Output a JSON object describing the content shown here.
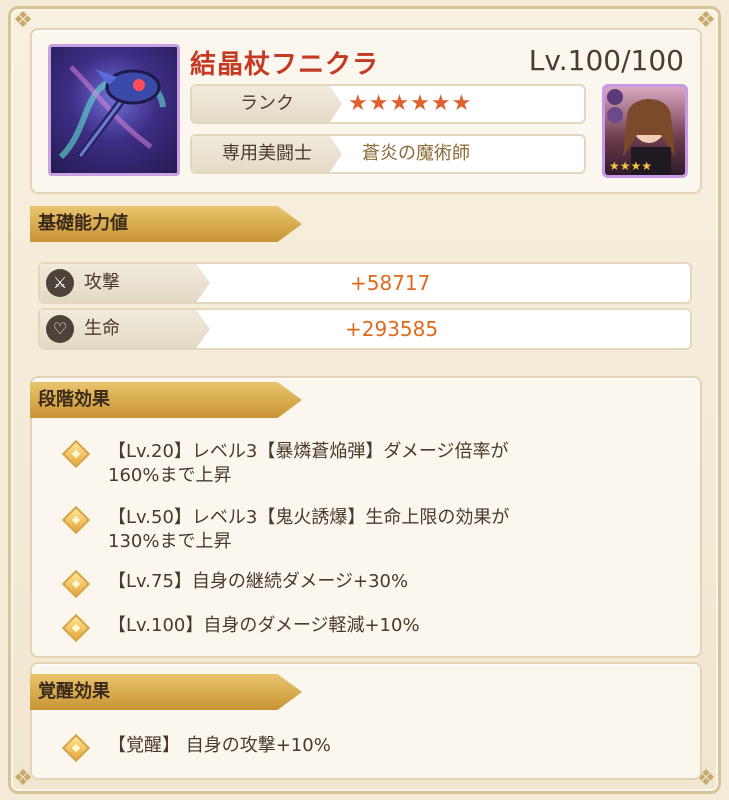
{
  "item": {
    "name": "結晶杖フニクラ",
    "level": "Lv.100/100",
    "rank_label": "ランク",
    "rank_stars": "★★★★★★",
    "rank_value": 6,
    "exclusive_label": "専用美闘士",
    "exclusive_value": "蒼炎の魔術師"
  },
  "sections": {
    "base_stats_title": "基礎能力値",
    "stage_effects_title": "段階効果",
    "awakening_title": "覚醒効果"
  },
  "stats": [
    {
      "label": "攻撃",
      "value": "+58717",
      "icon": "crossed-swords-icon"
    },
    {
      "label": "生命",
      "value": "+293585",
      "icon": "heart-icon"
    }
  ],
  "stage_effects": [
    {
      "line1": "【Lv.20】レベル3【暴燐蒼焔弾】ダメージ倍率が",
      "line2": "160%まで上昇"
    },
    {
      "line1": "【Lv.50】レベル3【鬼火誘爆】生命上限の効果が",
      "line2": "130%まで上昇"
    },
    {
      "line1": "【Lv.75】自身の継続ダメージ+30%",
      "line2": ""
    },
    {
      "line1": "【Lv.100】自身のダメージ軽減+10%",
      "line2": ""
    }
  ],
  "awakening_effects": [
    {
      "text": "【覚醒】 自身の攻撃+10%"
    }
  ],
  "portrait": {
    "stars": "★★★★"
  },
  "colors": {
    "title": "#c43a23",
    "value_orange": "#e06a1c",
    "section_gold": "#d9ad4f"
  }
}
